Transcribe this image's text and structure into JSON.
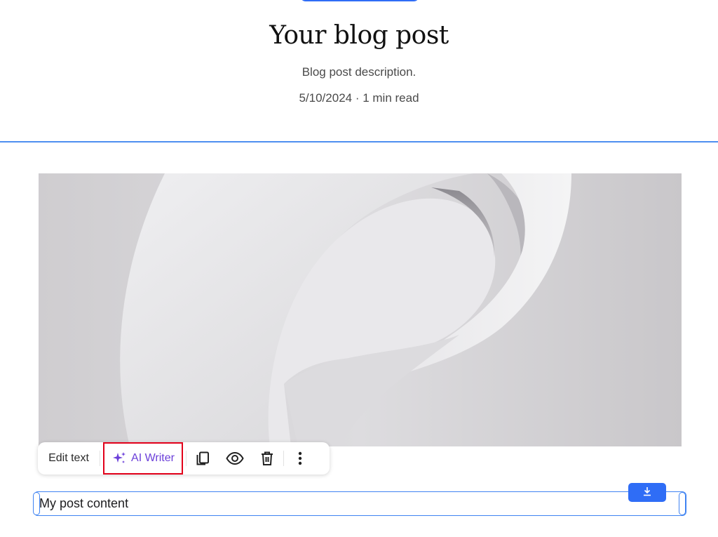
{
  "post": {
    "title": "Your blog post",
    "description": "Blog post description.",
    "meta": "5/10/2024 · 1 min read",
    "content": "My post content"
  },
  "toolbar": {
    "edit_label": "Edit text",
    "ai_writer_label": "AI Writer",
    "icons": [
      "sparkle-icon",
      "duplicate-icon",
      "eye-icon",
      "trash-icon",
      "more-vertical-icon"
    ]
  },
  "colors": {
    "accent": "#2f6df6",
    "selection": "#3f83f2",
    "ai_purple": "#6b3fd9",
    "highlight_red": "#e2001a"
  }
}
